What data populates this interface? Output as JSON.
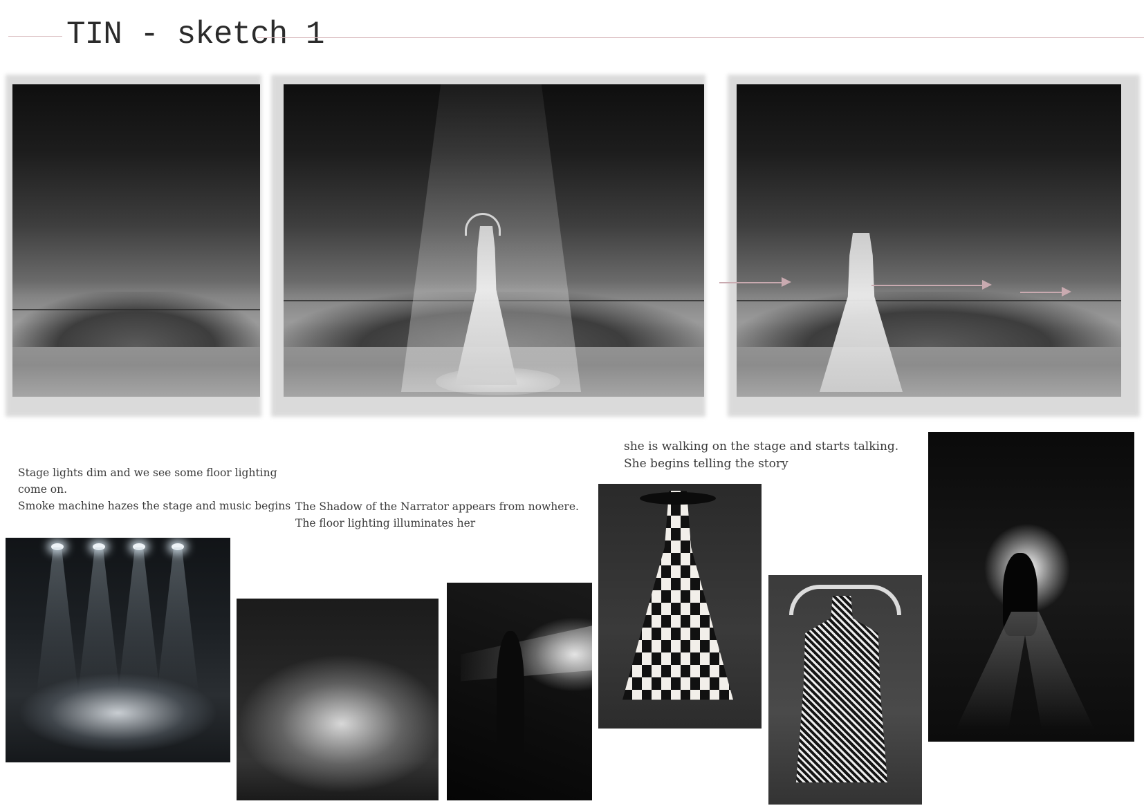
{
  "title": "TIN - sketch 1",
  "captions": {
    "scene1": [
      "Stage lights dim and we see some floor lighting",
      "come on.",
      "Smoke machine hazes the stage and music begins"
    ],
    "scene2": [
      "The Shadow of the Narrator appears from nowhere.",
      "The floor lighting illuminates her"
    ],
    "scene3": [
      "she is walking  on the stage  and starts talking.",
      "She begins telling the story"
    ]
  },
  "colors": {
    "rule": "#d8b9bd",
    "arrow": "#c9aab0",
    "text": "#3a3a3a"
  }
}
